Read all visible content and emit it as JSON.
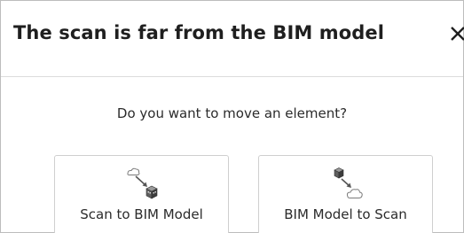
{
  "dialog": {
    "title": "The scan is far from the BIM model",
    "question": "Do you want to move an element?",
    "options": [
      {
        "label": "Scan to BIM Model",
        "icon": "scan-to-bim-icon"
      },
      {
        "label": "BIM Model to Scan",
        "icon": "bim-to-scan-icon"
      }
    ],
    "close_icon": "close-icon"
  }
}
